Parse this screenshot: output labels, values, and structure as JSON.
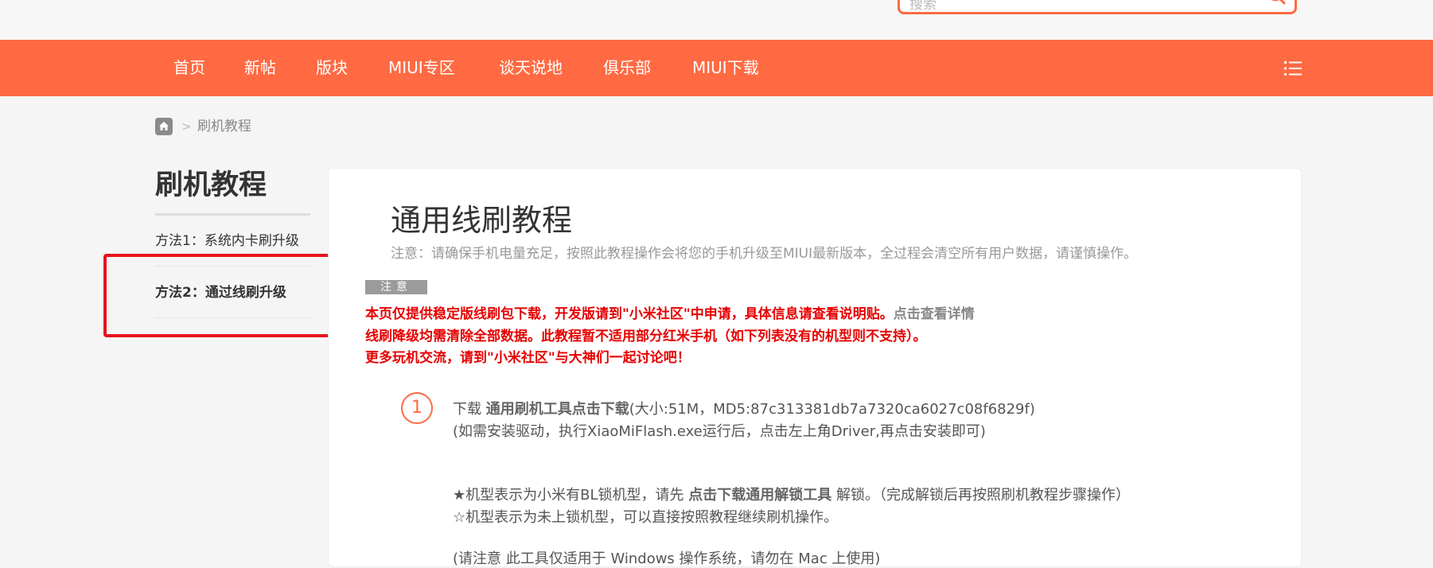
{
  "header": {
    "search_placeholder": "搜索"
  },
  "nav": {
    "items": [
      "首页",
      "新帖",
      "版块",
      "MIUI专区",
      "谈天说地",
      "俱乐部",
      "MIUI下载"
    ]
  },
  "breadcrumb": {
    "separator": ">",
    "current": "刷机教程"
  },
  "sidebar": {
    "title": "刷机教程",
    "items": [
      "方法1：系统内卡刷升级",
      "方法2：通过线刷升级"
    ]
  },
  "main": {
    "title": "通用线刷教程",
    "subtitle": "注意：请确保手机电量充足，按照此教程操作会将您的手机升级至MIUI最新版本，全过程会清空所有用户数据，请谨慎操作。",
    "notice_badge": "注意",
    "notice_line1": "本页仅提供稳定版线刷包下载，开发版请到\"小米社区\"中申请，具体信息请查看说明贴。",
    "notice_line1_link": "点击查看详情",
    "notice_line2": "线刷降级均需清除全部数据。此教程暂不适用部分红米手机（如下列表没有的机型则不支持）。",
    "notice_line3": "更多玩机交流，请到\"小米社区\"与大神们一起讨论吧！",
    "step1": {
      "number": "1",
      "line1_prefix": "下载 ",
      "line1_link": "通用刷机工具点击下载",
      "line1_suffix": "(大小:51M，MD5:87c313381db7a7320ca6027c08f6829f)",
      "line2": "(如需安装驱动，执行XiaoMiFlash.exe运行后，点击左上角Driver,再点击安装即可)",
      "line3_prefix": "★机型表示为小米有BL锁机型，请先 ",
      "line3_link": "点击下载通用解锁工具",
      "line3_suffix": " 解锁。（完成解锁后再按照刷机教程步骤操作）",
      "line4": "☆机型表示为未上锁机型，可以直接按照教程继续刷机操作。",
      "line5": "(请注意 此工具仅适用于 Windows 操作系统，请勿在 Mac 上使用)"
    }
  },
  "colors": {
    "brand": "#ff6a42",
    "notice_red": "#e60000",
    "highlight_red": "#e8141c"
  }
}
